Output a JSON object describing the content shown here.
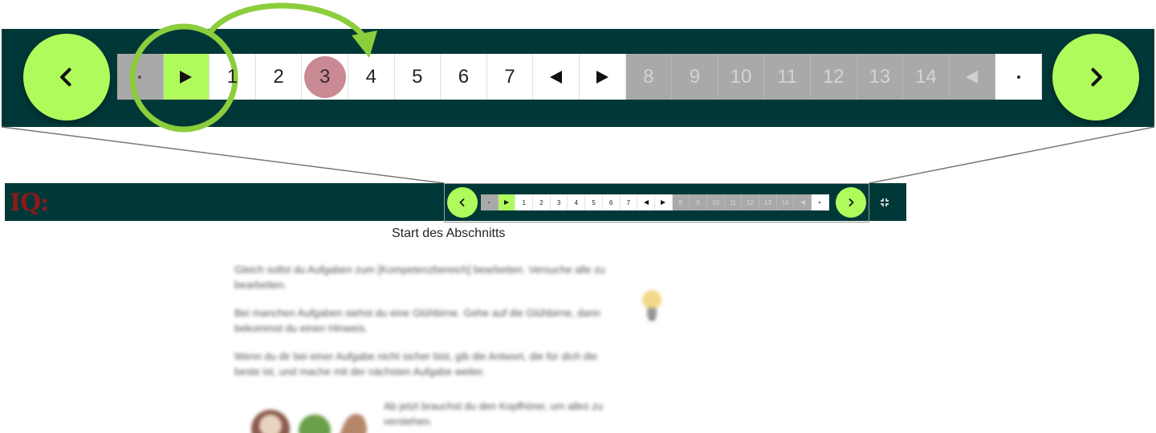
{
  "colors": {
    "bar_bg": "#003838",
    "accent_green": "#b0fb5c",
    "current_marker": "#c98a93",
    "locked_grey": "#a9a9a9",
    "logo_red": "#8b1a1a"
  },
  "logo": {
    "text": "IQ:"
  },
  "navigation": {
    "prev_icon": "chevron-left-icon",
    "next_icon": "chevron-right-icon",
    "cells": [
      {
        "label": "·",
        "kind": "dot",
        "state": "locked"
      },
      {
        "label": "▶",
        "kind": "arrow-right",
        "state": "active"
      },
      {
        "label": "1",
        "kind": "number",
        "state": "open"
      },
      {
        "label": "2",
        "kind": "number",
        "state": "open"
      },
      {
        "label": "3",
        "kind": "number",
        "state": "current"
      },
      {
        "label": "4",
        "kind": "number",
        "state": "open"
      },
      {
        "label": "5",
        "kind": "number",
        "state": "open"
      },
      {
        "label": "6",
        "kind": "number",
        "state": "open"
      },
      {
        "label": "7",
        "kind": "number",
        "state": "open"
      },
      {
        "label": "◀",
        "kind": "arrow-left",
        "state": "open"
      },
      {
        "label": "▶",
        "kind": "arrow-right",
        "state": "open"
      },
      {
        "label": "8",
        "kind": "number",
        "state": "locked"
      },
      {
        "label": "9",
        "kind": "number",
        "state": "locked"
      },
      {
        "label": "10",
        "kind": "number",
        "state": "locked"
      },
      {
        "label": "11",
        "kind": "number",
        "state": "locked"
      },
      {
        "label": "12",
        "kind": "number",
        "state": "locked"
      },
      {
        "label": "13",
        "kind": "number",
        "state": "locked"
      },
      {
        "label": "14",
        "kind": "number",
        "state": "locked"
      },
      {
        "label": "◀",
        "kind": "arrow-left",
        "state": "locked"
      },
      {
        "label": "·",
        "kind": "dot",
        "state": "open"
      }
    ]
  },
  "fullscreen_icon": "fullscreen-exit-icon",
  "section_label": "Start des Abschnitts",
  "content": {
    "paragraphs": [
      "Gleich sollst du Aufgaben zum [Kompetenzbereich] bearbeiten. Versuche alle zu bearbeiten.",
      "Bei manchen Aufgaben siehst du eine Glühbirne. Gehe auf die Glühbirne, dann bekommst du einen Hinweis.",
      "Wenn du dir bei einer Aufgabe nicht sicher bist, gib die Antwort, die für dich die beste ist, und mache mit der nächsten Aufgabe weiter."
    ],
    "headphone_text": "Ab jetzt brauchst du den Kopfhörer, um alles zu verstehen.",
    "bulb_icon": "lightbulb-icon",
    "headphones_icon": "headphones-characters-illustration"
  }
}
